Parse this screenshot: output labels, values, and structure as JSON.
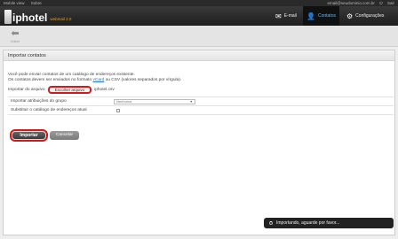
{
  "topbar": {
    "mobile_view": "Mobile view",
    "about": "Sobre",
    "user_email": "email@seudominio.com.br",
    "logout": "Sair"
  },
  "header": {
    "logo_name": "iphotel",
    "logo_edition": "webmail 2.0"
  },
  "nav": {
    "email": "E-mail",
    "contacts": "Contatos",
    "settings": "Configurações"
  },
  "toolbar": {
    "back_label": "Voltar"
  },
  "panel": {
    "title": "Importar contatos",
    "intro_line1": "Você pode enviar contatos de um catálogo de endereços existente.",
    "intro_line2_pre": "Os contatos devem ser enviados no formato ",
    "intro_line2_vcard": "vCard",
    "intro_line2_post": " ou CSV (valores separados por vírgula).",
    "upload_label": "Importar do arquivo",
    "choose_file": "Escolher arquivo",
    "file_name": "iphotel.csv",
    "group_label": "Importar atribuições do grupo",
    "group_value": "Nenhuma",
    "replace_label": "Substituir o catálogo de endereços atual",
    "replace_checked": false
  },
  "buttons": {
    "import": "Importar",
    "cancel": "Cancelar"
  },
  "status": {
    "message": "Importando, aguarde por favor..."
  },
  "colors": {
    "highlight": "#d21a1a",
    "accent": "#6eb5e8"
  }
}
